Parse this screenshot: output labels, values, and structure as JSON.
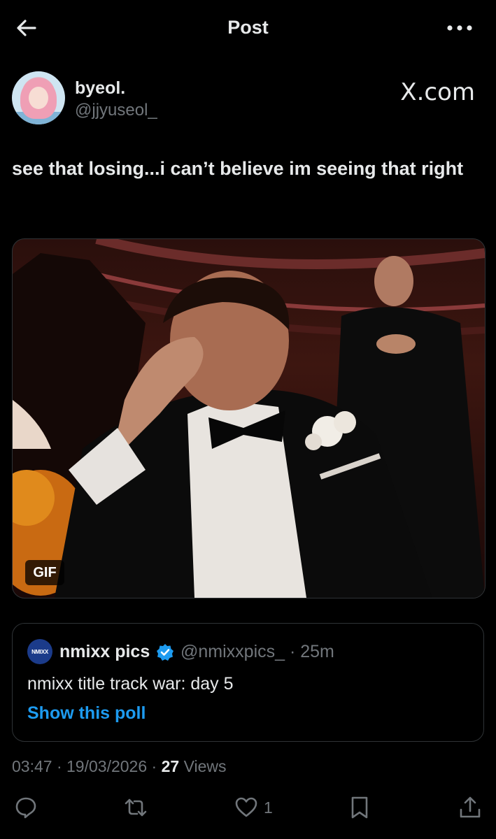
{
  "header": {
    "title": "Post",
    "back_icon": "arrow-left-icon",
    "more_icon": "more-horizontal-icon"
  },
  "post": {
    "author": {
      "display_name": "byeol.",
      "handle": "@jjyuseol_",
      "avatar_icon": "avatar-image"
    },
    "source_label": "X.com",
    "text": "see that losing...i can’t believe im seeing that right",
    "media": {
      "type_badge": "GIF"
    },
    "quote": {
      "avatar_text": "NMIXX",
      "display_name": "nmixx pics",
      "verified_icon": "verified-badge-icon",
      "handle_time": "@nmixxpics_ · 25m",
      "text": "nmixx title track war: day 5",
      "poll_link": "Show this poll"
    },
    "meta": {
      "time": "03:47",
      "separator": "·",
      "date": "19/03/2026",
      "views_count": "27",
      "views_label": "Views"
    },
    "actions": {
      "reply_icon": "reply-icon",
      "repost_icon": "repost-icon",
      "like_icon": "heart-icon",
      "like_count": "1",
      "bookmark_icon": "bookmark-icon",
      "share_icon": "share-icon"
    }
  },
  "colors": {
    "background": "#000000",
    "text_primary": "#e7e9ea",
    "text_secondary": "#71767b",
    "accent": "#1d9bf0",
    "border": "#2f3336"
  }
}
